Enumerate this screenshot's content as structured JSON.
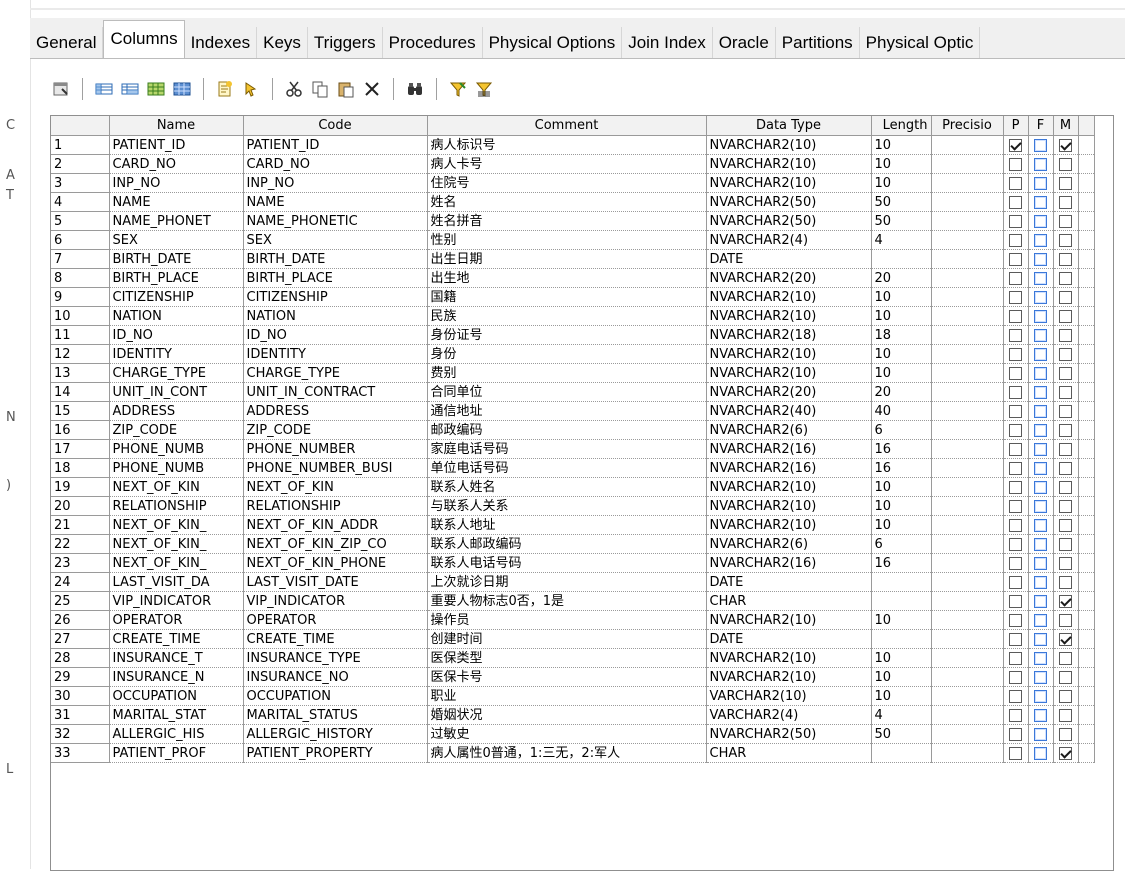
{
  "tabs": [
    "General",
    "Columns",
    "Indexes",
    "Keys",
    "Triggers",
    "Procedures",
    "Physical Options",
    "Join Index",
    "Oracle",
    "Partitions",
    "Physical Optic"
  ],
  "active_tab": "Columns",
  "columns": {
    "name": "Name",
    "code": "Code",
    "comment": "Comment",
    "data_type": "Data Type",
    "length": "Length",
    "precision": "Precisio",
    "p": "P",
    "f": "F",
    "m": "M"
  },
  "rows": [
    {
      "num": "1",
      "name": "PATIENT_ID",
      "code": "PATIENT_ID",
      "comment": "病人标识号",
      "type": "NVARCHAR2(10)",
      "length": "10",
      "p": true,
      "m": true
    },
    {
      "num": "2",
      "name": "CARD_NO",
      "code": "CARD_NO",
      "comment": "病人卡号",
      "type": "NVARCHAR2(10)",
      "length": "10",
      "p": false,
      "m": false
    },
    {
      "num": "3",
      "name": "INP_NO",
      "code": "INP_NO",
      "comment": "住院号",
      "type": "NVARCHAR2(10)",
      "length": "10",
      "p": false,
      "m": false
    },
    {
      "num": "4",
      "name": "NAME",
      "code": "NAME",
      "comment": "姓名",
      "type": "NVARCHAR2(50)",
      "length": "50",
      "p": false,
      "m": false
    },
    {
      "num": "5",
      "name": "NAME_PHONET",
      "code": "NAME_PHONETIC",
      "comment": "姓名拼音",
      "type": "NVARCHAR2(50)",
      "length": "50",
      "p": false,
      "m": false
    },
    {
      "num": "6",
      "name": "SEX",
      "code": "SEX",
      "comment": "性别",
      "type": "NVARCHAR2(4)",
      "length": "4",
      "p": false,
      "m": false
    },
    {
      "num": "7",
      "name": "BIRTH_DATE",
      "code": "BIRTH_DATE",
      "comment": "出生日期",
      "type": "DATE",
      "length": "",
      "p": false,
      "m": false
    },
    {
      "num": "8",
      "name": "BIRTH_PLACE",
      "code": "BIRTH_PLACE",
      "comment": "出生地",
      "type": "NVARCHAR2(20)",
      "length": "20",
      "p": false,
      "m": false
    },
    {
      "num": "9",
      "name": "CITIZENSHIP",
      "code": "CITIZENSHIP",
      "comment": "国籍",
      "type": "NVARCHAR2(10)",
      "length": "10",
      "p": false,
      "m": false
    },
    {
      "num": "10",
      "name": "NATION",
      "code": "NATION",
      "comment": "民族",
      "type": "NVARCHAR2(10)",
      "length": "10",
      "p": false,
      "m": false
    },
    {
      "num": "11",
      "name": "ID_NO",
      "code": "ID_NO",
      "comment": "身份证号",
      "type": "NVARCHAR2(18)",
      "length": "18",
      "p": false,
      "m": false
    },
    {
      "num": "12",
      "name": "IDENTITY",
      "code": "IDENTITY",
      "comment": "身份",
      "type": "NVARCHAR2(10)",
      "length": "10",
      "p": false,
      "m": false
    },
    {
      "num": "13",
      "name": "CHARGE_TYPE",
      "code": "CHARGE_TYPE",
      "comment": "费别",
      "type": "NVARCHAR2(10)",
      "length": "10",
      "p": false,
      "m": false
    },
    {
      "num": "14",
      "name": "UNIT_IN_CONT",
      "code": "UNIT_IN_CONTRACT",
      "comment": "合同单位",
      "type": "NVARCHAR2(20)",
      "length": "20",
      "p": false,
      "m": false
    },
    {
      "num": "15",
      "name": "ADDRESS",
      "code": "ADDRESS",
      "comment": "通信地址",
      "type": "NVARCHAR2(40)",
      "length": "40",
      "p": false,
      "m": false
    },
    {
      "num": "16",
      "name": "ZIP_CODE",
      "code": "ZIP_CODE",
      "comment": "邮政编码",
      "type": "NVARCHAR2(6)",
      "length": "6",
      "p": false,
      "m": false
    },
    {
      "num": "17",
      "name": "PHONE_NUMB",
      "code": "PHONE_NUMBER",
      "comment": "家庭电话号码",
      "type": "NVARCHAR2(16)",
      "length": "16",
      "p": false,
      "m": false
    },
    {
      "num": "18",
      "name": "PHONE_NUMB",
      "code": "PHONE_NUMBER_BUSI",
      "comment": "单位电话号码",
      "type": "NVARCHAR2(16)",
      "length": "16",
      "p": false,
      "m": false
    },
    {
      "num": "19",
      "name": "NEXT_OF_KIN",
      "code": "NEXT_OF_KIN",
      "comment": "联系人姓名",
      "type": "NVARCHAR2(10)",
      "length": "10",
      "p": false,
      "m": false
    },
    {
      "num": "20",
      "name": "RELATIONSHIP",
      "code": "RELATIONSHIP",
      "comment": "与联系人关系",
      "type": "NVARCHAR2(10)",
      "length": "10",
      "p": false,
      "m": false
    },
    {
      "num": "21",
      "name": "NEXT_OF_KIN_",
      "code": "NEXT_OF_KIN_ADDR",
      "comment": "联系人地址",
      "type": "NVARCHAR2(10)",
      "length": "10",
      "p": false,
      "m": false
    },
    {
      "num": "22",
      "name": "NEXT_OF_KIN_",
      "code": "NEXT_OF_KIN_ZIP_CO",
      "comment": "联系人邮政编码",
      "type": "NVARCHAR2(6)",
      "length": "6",
      "p": false,
      "m": false
    },
    {
      "num": "23",
      "name": "NEXT_OF_KIN_",
      "code": "NEXT_OF_KIN_PHONE",
      "comment": "联系人电话号码",
      "type": "NVARCHAR2(16)",
      "length": "16",
      "p": false,
      "m": false
    },
    {
      "num": "24",
      "name": "LAST_VISIT_DA",
      "code": "LAST_VISIT_DATE",
      "comment": "上次就诊日期",
      "type": "DATE",
      "length": "",
      "p": false,
      "m": false
    },
    {
      "num": "25",
      "name": "VIP_INDICATOR",
      "code": "VIP_INDICATOR",
      "comment": "重要人物标志0否，1是",
      "type": "CHAR",
      "length": "",
      "p": false,
      "m": true
    },
    {
      "num": "26",
      "name": "OPERATOR",
      "code": "OPERATOR",
      "comment": "操作员",
      "type": "NVARCHAR2(10)",
      "length": "10",
      "p": false,
      "m": false
    },
    {
      "num": "27",
      "name": "CREATE_TIME",
      "code": "CREATE_TIME",
      "comment": "创建时间",
      "type": "DATE",
      "length": "",
      "p": false,
      "m": true
    },
    {
      "num": "28",
      "name": "INSURANCE_T",
      "code": "INSURANCE_TYPE",
      "comment": "医保类型",
      "type": "NVARCHAR2(10)",
      "length": "10",
      "p": false,
      "m": false
    },
    {
      "num": "29",
      "name": "INSURANCE_N",
      "code": "INSURANCE_NO",
      "comment": "医保卡号",
      "type": "NVARCHAR2(10)",
      "length": "10",
      "p": false,
      "m": false
    },
    {
      "num": "30",
      "name": "OCCUPATION",
      "code": "OCCUPATION",
      "comment": "职业",
      "type": "VARCHAR2(10)",
      "length": "10",
      "p": false,
      "m": false
    },
    {
      "num": "31",
      "name": "MARITAL_STAT",
      "code": "MARITAL_STATUS",
      "comment": "婚姻状况",
      "type": "VARCHAR2(4)",
      "length": "4",
      "p": false,
      "m": false
    },
    {
      "num": "32",
      "name": "ALLERGIC_HIS",
      "code": "ALLERGIC_HISTORY",
      "comment": "过敏史",
      "type": "NVARCHAR2(50)",
      "length": "50",
      "p": false,
      "m": false
    },
    {
      "num": "33",
      "name": "PATIENT_PROF",
      "code": "PATIENT_PROPERTY",
      "comment": "病人属性0普通，1:三无，2:军人",
      "type": "CHAR",
      "length": "",
      "p": false,
      "m": true
    }
  ],
  "toolbar_icons": [
    "properties-icon",
    "insert-row-icon",
    "add-row-icon",
    "add-columns-icon",
    "replicate-icon",
    "new-icon",
    "find-icon",
    "cut-icon",
    "copy-icon",
    "paste-icon",
    "delete-icon",
    "find-binoculars-icon",
    "filter-icon",
    "clear-filter-icon"
  ],
  "colors": {
    "accent": "#3c78d8",
    "border": "#9a9a9a",
    "header_bg": "#f2f2f2"
  }
}
